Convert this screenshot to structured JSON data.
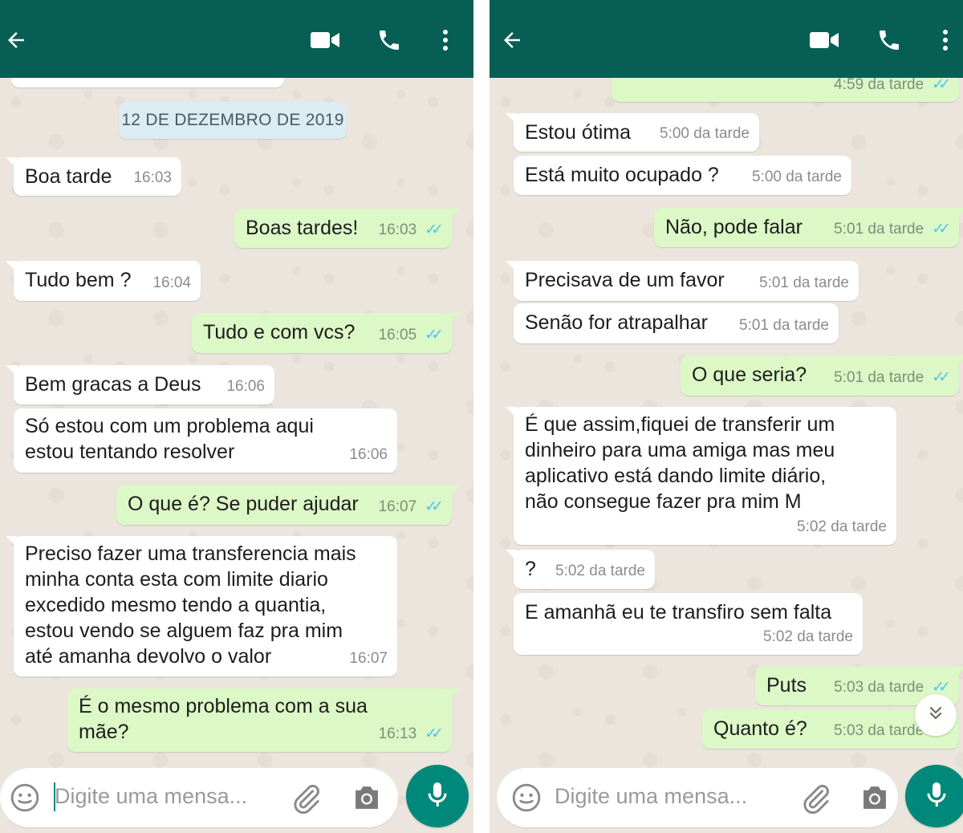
{
  "left_panel": {
    "date_chip": "12 DE DEZEMBRO DE 2019",
    "messages": [
      {
        "dir": "in",
        "text": "Boa tarde",
        "time": "16:03"
      },
      {
        "dir": "out",
        "text": "Boas tardes!",
        "time": "16:03"
      },
      {
        "dir": "in",
        "text": "Tudo bem ?",
        "time": "16:04"
      },
      {
        "dir": "out",
        "text": "Tudo e com vcs?",
        "time": "16:05"
      },
      {
        "dir": "in",
        "text": "Bem gracas a Deus",
        "time": "16:06"
      },
      {
        "dir": "in",
        "lines": [
          "Só estou com um problema aqui",
          "estou tentando resolver"
        ],
        "time": "16:06"
      },
      {
        "dir": "out",
        "text": "O que é? Se puder ajudar",
        "time": "16:07"
      },
      {
        "dir": "in",
        "lines": [
          "Preciso fazer uma transferencia mais",
          "minha conta esta com limite diario",
          "excedido mesmo tendo a quantia,",
          "estou vendo se alguem faz pra mim",
          "até amanha devolvo o valor"
        ],
        "time": "16:07"
      },
      {
        "dir": "out",
        "lines": [
          "É o mesmo problema com a sua",
          "mãe?"
        ],
        "time": "16:13"
      }
    ],
    "composer": {
      "placeholder": "Digite uma mensa..."
    }
  },
  "right_panel": {
    "messages": [
      {
        "dir": "out",
        "text": "",
        "time": "4:59 da tarde"
      },
      {
        "dir": "in",
        "text": "Estou ótima",
        "time": "5:00 da tarde"
      },
      {
        "dir": "in",
        "text": "Está muito ocupado ?",
        "time": "5:00 da tarde"
      },
      {
        "dir": "out",
        "text": "Não, pode falar",
        "time": "5:01 da tarde"
      },
      {
        "dir": "in",
        "text": "Precisava de um favor",
        "time": "5:01 da tarde"
      },
      {
        "dir": "in",
        "text": "Senão for atrapalhar",
        "time": "5:01 da tarde"
      },
      {
        "dir": "out",
        "text": "O que seria?",
        "time": "5:01 da tarde"
      },
      {
        "dir": "in",
        "lines": [
          "É que assim,fiquei de transferir um",
          "dinheiro para uma amiga mas meu",
          "aplicativo está dando limite diário,",
          "não consegue fazer pra mim M"
        ],
        "time": "5:02 da tarde"
      },
      {
        "dir": "in",
        "text": "?",
        "time": "5:02 da tarde"
      },
      {
        "dir": "in",
        "text": "E amanhã eu te transfiro sem falta",
        "time": "5:02 da tarde"
      },
      {
        "dir": "out",
        "text": "Puts",
        "time": "5:03 da tarde"
      },
      {
        "dir": "out",
        "text": "Quanto é?",
        "time": "5:03 da tarde"
      }
    ],
    "composer": {
      "placeholder": "Digite uma mensa..."
    }
  },
  "icons": {
    "back": "arrow-left-icon",
    "video": "video-camera-icon",
    "call": "phone-icon",
    "more": "more-vertical-icon",
    "emoji": "emoji-icon",
    "attach": "paperclip-icon",
    "camera": "camera-icon",
    "mic": "microphone-icon",
    "scroll_down": "double-chevron-down-icon"
  },
  "colors": {
    "header": "#075e54",
    "chat_background": "#ece5dd",
    "incoming_bubble": "#ffffff",
    "outgoing_bubble": "#dcf8c6",
    "read_ticks": "#4fc3f7",
    "mic_button": "#00897b"
  }
}
